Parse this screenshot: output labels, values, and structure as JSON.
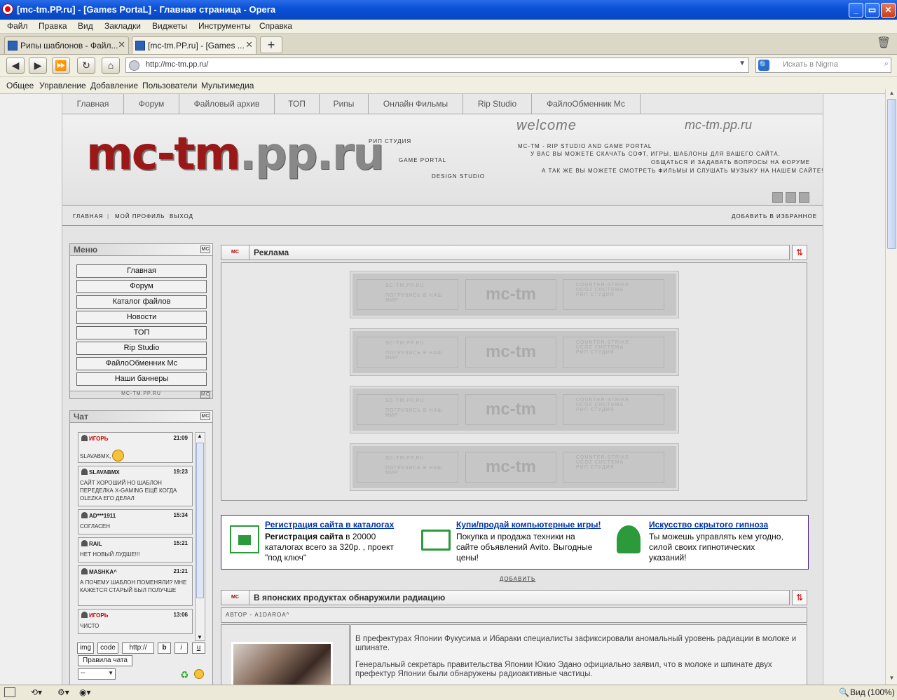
{
  "window": {
    "title": "[mc-tm.PP.ru] - [Games PortaL] - Главная страница - Opera"
  },
  "menu": [
    "Файл",
    "Правка",
    "Вид",
    "Закладки",
    "Виджеты",
    "Инструменты",
    "Справка"
  ],
  "tabs": [
    {
      "label": "Рипы шаблонов - Файл..."
    },
    {
      "label": "[mc-tm.PP.ru] - [Games ..."
    }
  ],
  "address": {
    "url": "http://mc-tm.pp.ru/",
    "search_placeholder": "Искать в Nigma"
  },
  "panel": [
    "Общее",
    "Управление",
    "Добавление",
    "Пользователи",
    "Мультимедиа"
  ],
  "site": {
    "nav": [
      "Главная",
      "Форум",
      "Файловый архив",
      "ТОП",
      "Рипы",
      "Онлайн Фильмы",
      "Rip Studio",
      "ФайлоОбменник Мс"
    ],
    "logo_main": "mc-tm",
    "logo_suffix": ".pp.ru",
    "tag1": "рип студия",
    "tag2": "game portal",
    "tag3": "design studio",
    "welcome": "welcome",
    "sitename": "mc-tm.pp.ru",
    "header_lines": [
      "mc-tm - rip studio and game portal",
      "у вас вы можете скачать софт, игры, шаблоны для вашего сайта.",
      "общаться и задавать вопросы на форуме",
      "а так же вы можете смотреть фильмы и слушать музыку на нашем сайте!"
    ],
    "userbar": {
      "home": "главная",
      "profile": "мой профиль",
      "exit": "выход",
      "favorite": "добавить в избранное"
    }
  },
  "menu_block": {
    "title": "Меню",
    "mc": "MC",
    "items": [
      "Главная",
      "Форум",
      "Каталог файлов",
      "Новости",
      "ТОП",
      "Rip Studio",
      "ФайлоОбменник Мс",
      "Наши баннеры"
    ],
    "footer": "mc-tm.pp.ru"
  },
  "chat": {
    "title": "Чат",
    "messages": [
      {
        "user": "игорь",
        "time": "21:09",
        "text": "slavabmx,"
      },
      {
        "user": "slavabmx",
        "time": "19:23",
        "text": "сайт хороший но шаблон переделка x-gaming ещё когда olezka его делал"
      },
      {
        "user": "ad***1911",
        "time": "15:34",
        "text": "согласен"
      },
      {
        "user": "rail",
        "time": "15:21",
        "text": "нет новый лудше!!!"
      },
      {
        "user": "mashka^",
        "time": "21:21",
        "text": "а почему шаблон поменяли? мне кажется старый был получше"
      },
      {
        "user": "игорь",
        "time": "13:06",
        "text": "чисто"
      }
    ],
    "buttons": [
      "img",
      "code",
      "http://",
      "b",
      "i",
      "u"
    ],
    "rules": "Правила чата",
    "select": "--"
  },
  "ads": {
    "title": "Реклама",
    "mc": "MC",
    "banner_left": [
      "sc-tm.pp.ru",
      "погрузись в наш мир"
    ],
    "banner_mid": "mc-tm",
    "banner_right": [
      "counter-strike",
      "ucoz система",
      "рип студия"
    ]
  },
  "yandex": [
    {
      "title": "Регистрация сайта в каталогах",
      "bold": "Регистрация сайта",
      "text": " в 20000 каталогах всего за 320р. , проект \"под ключ\""
    },
    {
      "title": "Купи/продай компьютерные игры!",
      "text": "Покупка и продажа техники на сайте объявлений Avito. Выгодные цены!"
    },
    {
      "title": "Искусство скрытого гипноза",
      "text": "Ты можешь управлять кем угодно, силой своих гипнотических указаний!"
    }
  ],
  "add_link": "добавить",
  "news": {
    "mc": "MC",
    "title": "В японских продуктах обнаружили радиацию",
    "author": "автор - a1daroa^",
    "p1": "В префектурах Японии Фукусима и Ибараки специалисты зафиксировали аномальный уровень радиации в молоке и шпинате.",
    "p2": "Генеральный секретарь правительства Японии Юкио Эдано официально заявил, что в молоке и шпинате двух префектур Японии были обнаружены радиоактивные частицы."
  },
  "status": {
    "zoom": "Вид (100%)"
  }
}
